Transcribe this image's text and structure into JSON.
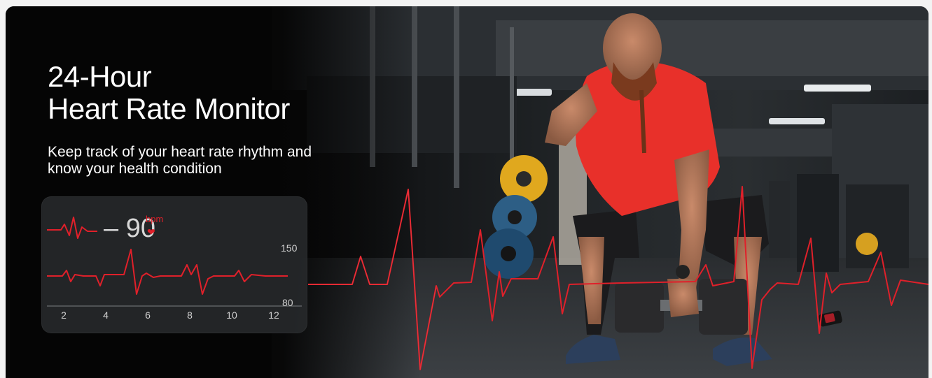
{
  "hero": {
    "title_line1": "24-Hour",
    "title_line2": "Heart Rate Monitor",
    "subtitle_line1": "Keep track of your heart rate rhythm and",
    "subtitle_line2": "know your health condition"
  },
  "widget": {
    "bpm_value": "– 90",
    "bpm_unit": "bpm",
    "heart_icon": "heart-icon",
    "scale_max": "150",
    "scale_min": "80",
    "x_ticks": [
      "2",
      "4",
      "6",
      "8",
      "10",
      "12"
    ]
  },
  "colors": {
    "accent_red": "#e0202a",
    "shirt_red": "#e8302a",
    "card_bg": "#26282a"
  }
}
